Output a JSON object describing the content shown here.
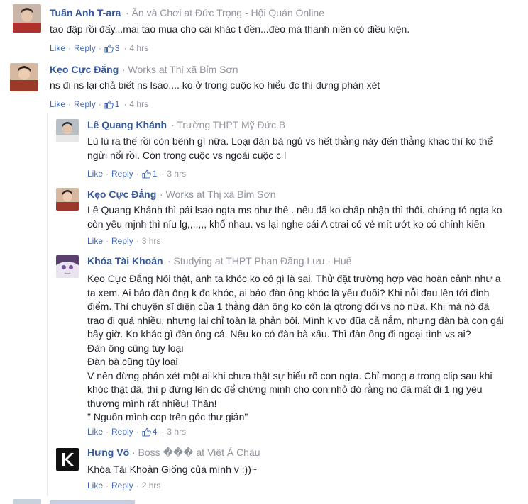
{
  "comments": [
    {
      "name": "Tuấn Anh T-ara",
      "meta": "· Ăn và Chơi at Đức Trọng - Hội Quán Online",
      "text": [
        "tao đập rồi đấy...mai tao mua cho cái khác t đền...đéo má thanh niên có điều kiện."
      ],
      "like": "Like",
      "reply": "Reply",
      "likes": "3",
      "time": "4 hrs"
    },
    {
      "name": "Kẹo Cực Đắng",
      "meta": "· Works at Thị xã Bỉm Sơn",
      "text": [
        "ns đi ns lại chả biết ns lsao.... ko ở trong cuộc ko hiểu đc thì đừng phán xét"
      ],
      "like": "Like",
      "reply": "Reply",
      "likes": "1",
      "time": "4 hrs"
    }
  ],
  "replies": [
    {
      "name": "Lê Quang Khánh",
      "meta": "· Trường THPT Mỹ Đức B",
      "text": [
        "Lù lù ra thế rồi còn bênh gì nữa. Loại đàn bà ngủ vs hết thằng này đến thằng khác thì ko thể",
        "ngửi nổi rồi. Còn trong cuộc vs ngoài cuộc c l"
      ],
      "like": "Like",
      "reply": "Reply",
      "likes": "1",
      "time": "3 hrs"
    },
    {
      "name": "Kẹo Cực Đắng",
      "meta": "· Works at Thị xã Bỉm Sơn",
      "text": [
        "Lê Quang Khánh thì pải lsao ngta ms như thế . nếu đã ko chấp nhận thì thôi. chứng tỏ ngta ko",
        "còn yêu mjnh thì níu lg,,,,,,, khổ nhau. vs lại nghe cái A ctrai có vẻ mít ướt ko có chính kiến"
      ],
      "like": "Like",
      "reply": "Reply",
      "likes": "",
      "time": "3 hrs"
    },
    {
      "name": "Khóa Tài Khoản",
      "meta": "· Studying at THPT Phan Đăng Lưu - Huế",
      "text": [
        "Kẹo Cực Đắng Nói thật, anh ta khóc ko có gì là sai. Thử đặt trường hợp vào hoàn cảnh như a",
        "ta xem. Ai bảo đàn ông k đc khóc, ai bảo đàn ông khóc là yếu đuối? Khi nỗi đau lên tới đỉnh",
        "điểm. Thì chuyện sĩ diện của 1 thằng đàn ông ko còn là qtrong đối vs nó nữa. Khi mà nó đã",
        "trao đi quá nhiều, nhưng lại chỉ toàn là phản bội. Mình k vơ đũa cả nắm, nhưng đàn bà con gái",
        "bây giờ. Ko khác gì đàn ông cả. Nếu ko có đàn bà xấu. Thì đàn ông đi ngoại tình vs ai?",
        "Đàn ông cũng tùy loại",
        "Đàn bà cũng tùy loại",
        "V nên đừng phán xét một ai khi chưa thật sự hiểu rõ con ngta. Chỉ mong a trong clip sau khi",
        "khóc thật đã, thì p đứng lên đc để chứng minh cho con nhỏ đó rằng nó đã mất đi 1 ng yêu",
        "thương mình rất nhiều! Thân!",
        "\" Nguồn mình cop trên góc thư giản\""
      ],
      "like": "Like",
      "reply": "Reply",
      "likes": "4",
      "time": "3 hrs"
    },
    {
      "name": "Hưng Võ",
      "meta": "· Boss ��� at Việt Á Châu",
      "text": [
        "Khóa Tài Khoản Giống của mình v :))~"
      ],
      "like": "Like",
      "reply": "Reply",
      "likes": "",
      "time": "2 hrs"
    }
  ],
  "colors": {
    "link": "#365899",
    "action": "#4267b2",
    "meta": "#90949c",
    "text": "#1d2129"
  }
}
